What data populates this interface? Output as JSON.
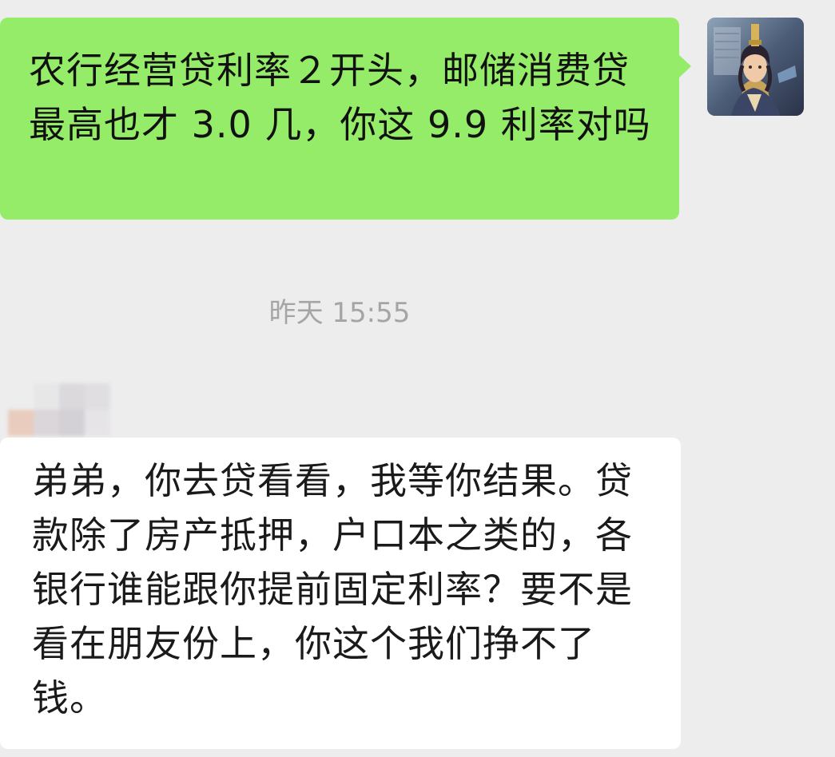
{
  "chat": {
    "outgoing_message": "农行经营贷利率２开头，邮储消费贷最高也才 3.0 几，你这 9.9 利率对吗",
    "timestamp": "昨天 15:55",
    "incoming_message": "弟弟，你去贷看看，我等你结果。贷款除了房产抵押，户口本之类的，各银行谁能跟你提前固定利率？要不是看在朋友份上，你这个我们挣不了钱。"
  },
  "colors": {
    "background": "#ededed",
    "outgoing_bubble": "#95ec69",
    "incoming_bubble": "#ffffff",
    "timestamp_text": "#a5a5a5"
  },
  "icons": {
    "self_avatar": "game-character-avatar",
    "contact_avatar": "blurred-avatar"
  }
}
